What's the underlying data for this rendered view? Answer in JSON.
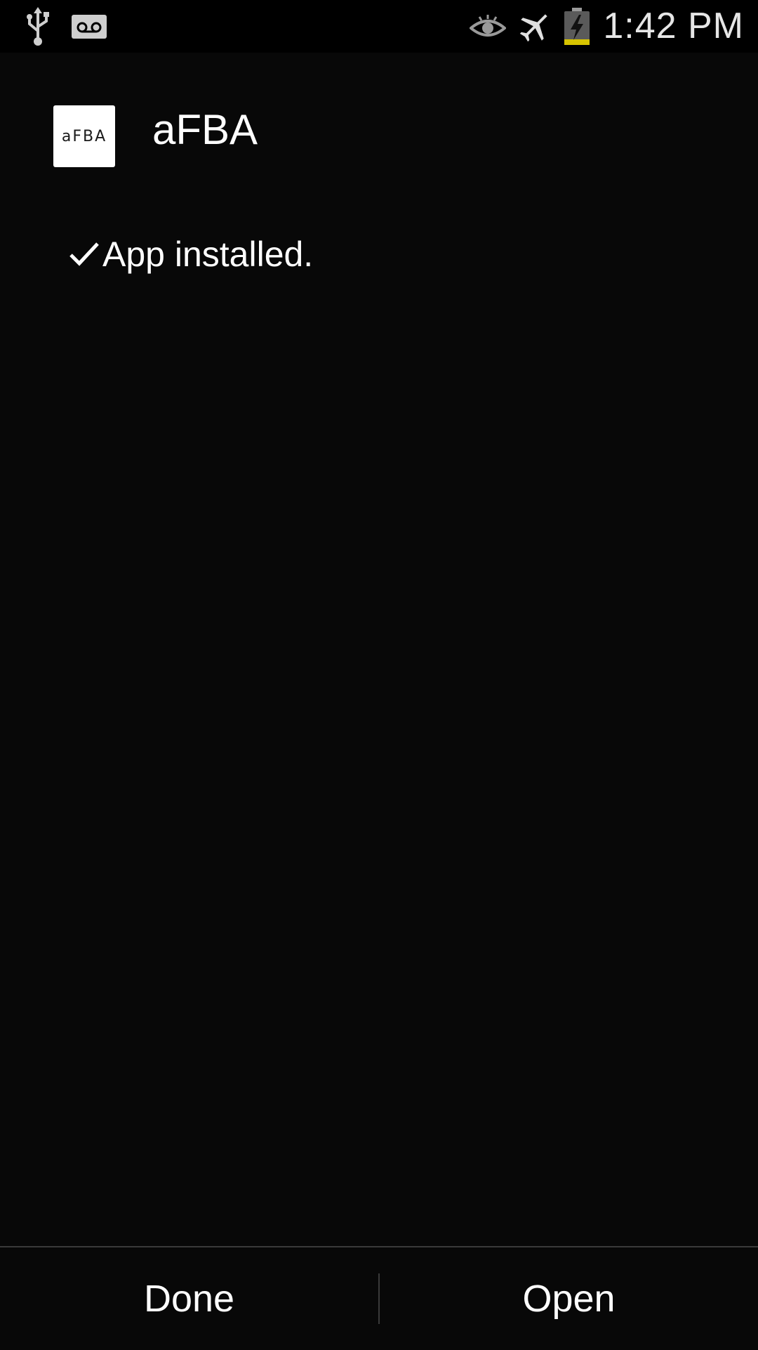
{
  "status_bar": {
    "time": "1:42 PM",
    "left_icons": [
      "usb-icon",
      "voicemail-icon"
    ],
    "right_icons": [
      "eye-icon",
      "airplane-mode-icon",
      "battery-charging-icon"
    ],
    "battery_color": "#d7c400"
  },
  "app": {
    "name": "aFBA",
    "icon_text": "aFBA"
  },
  "install": {
    "status": "App installed."
  },
  "buttons": {
    "done": "Done",
    "open": "Open"
  }
}
